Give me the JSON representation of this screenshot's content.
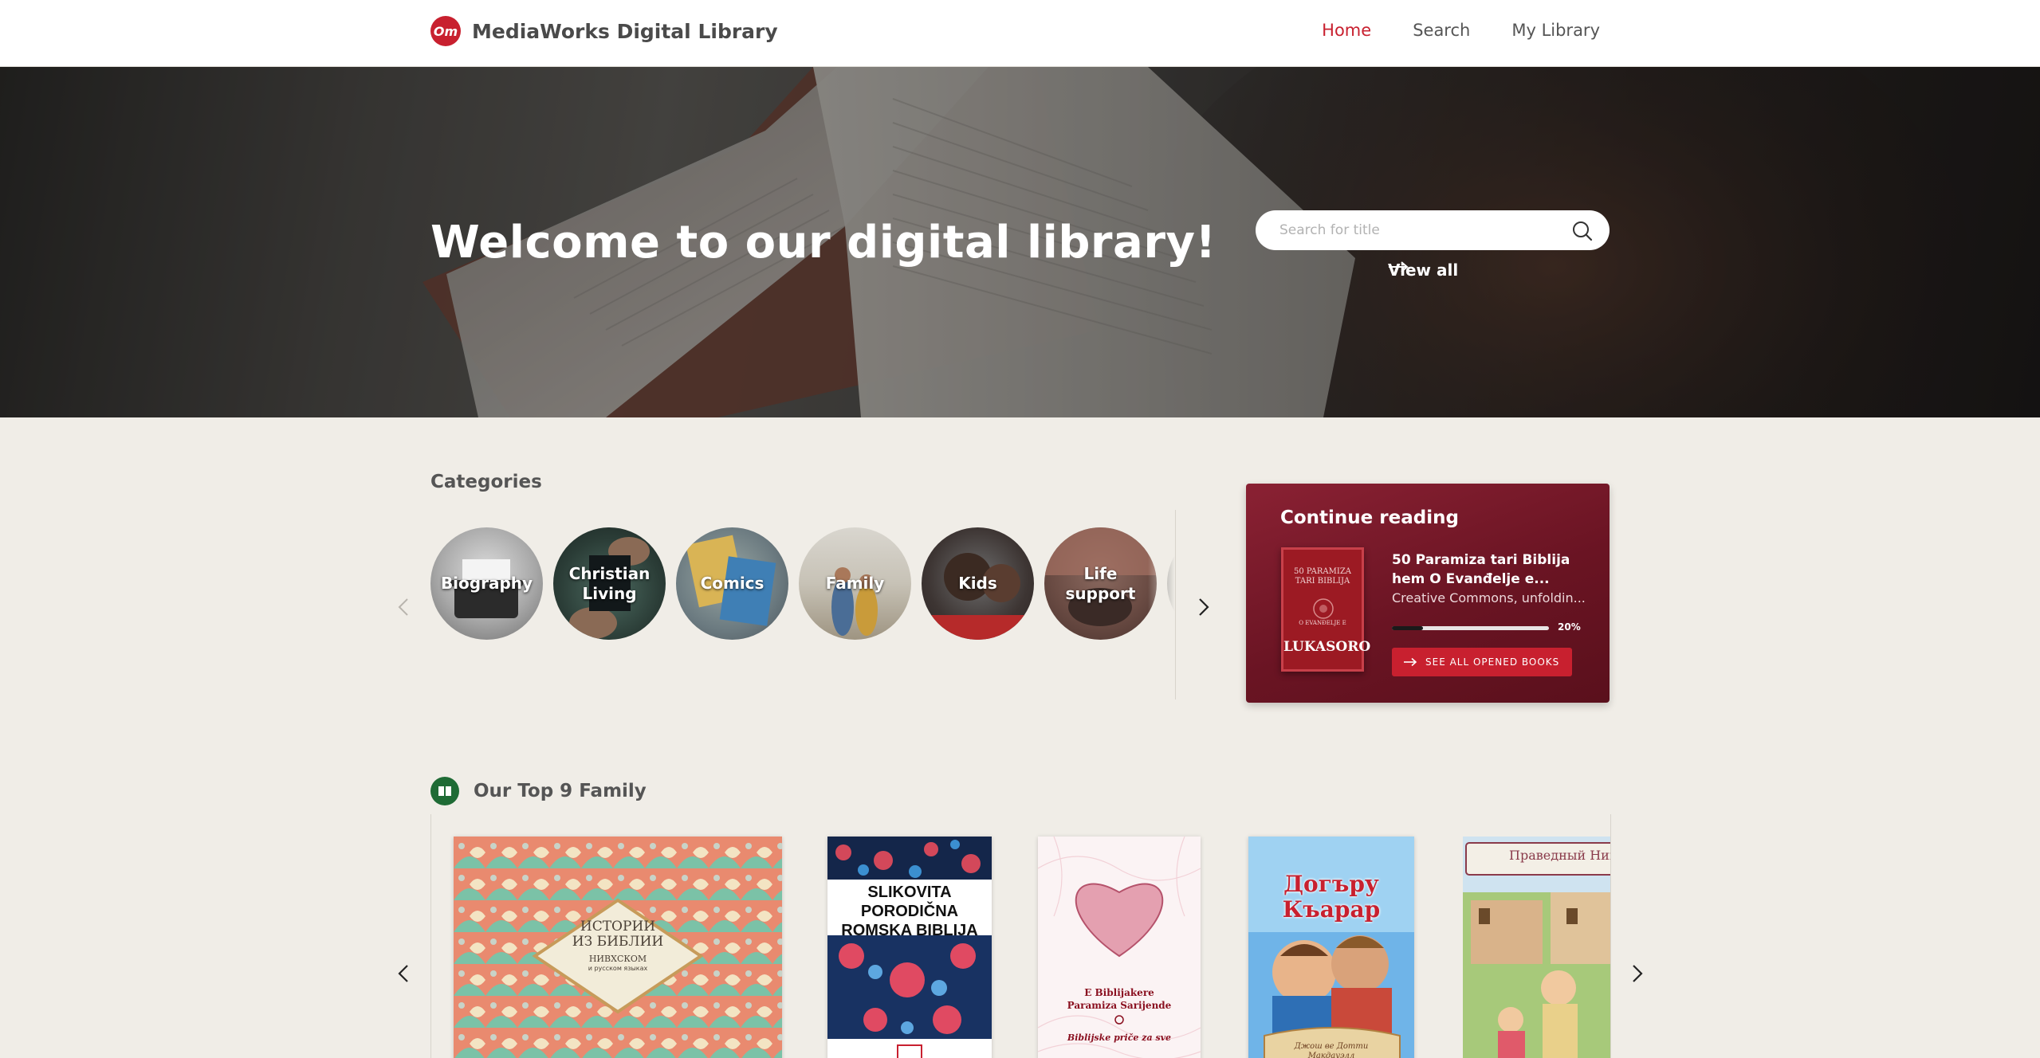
{
  "header": {
    "logo_text": "Om",
    "brand": "MediaWorks Digital Library",
    "nav": [
      {
        "label": "Home",
        "active": true
      },
      {
        "label": "Search",
        "active": false
      },
      {
        "label": "My Library",
        "active": false
      }
    ]
  },
  "hero": {
    "title": "Welcome to our digital library!",
    "search_placeholder": "Search for title",
    "view_all": "View all"
  },
  "categories": {
    "title": "Categories",
    "items": [
      "Biography",
      "Christian\nLiving",
      "Comics",
      "Family",
      "Kids",
      "Life\nsupport"
    ]
  },
  "continue_reading": {
    "title": "Continue reading",
    "book_title": "50 Paramiza tari Biblija hem O Evanđelje e...",
    "book_subtitle": "Creative Commons, unfoldin...",
    "cover_top": "50 PARAMIZA\nTARI BIBLIJA",
    "cover_mid": "O EVANĐELJE E",
    "cover_bottom": "LUKASORO",
    "progress_percent": 20,
    "progress_label": "20%",
    "button": "SEE ALL OPENED BOOKS"
  },
  "top9": {
    "title": "Our Top 9 Family",
    "books": [
      {
        "cover_title": "ИСТОРИИ\nИЗ БИБЛИИ",
        "cover_sub": "НИВХСКОМ",
        "cover_note": "и русском языках"
      },
      {
        "cover_title": "SLIKOVITA PORODIČNA\nROMSKA BIBLIJA"
      },
      {
        "cover_title": "E Biblijakere\nParamiza Sarijende",
        "cover_sub": "Biblijske priče za sve"
      },
      {
        "cover_title": "Догъру\nКъарар",
        "cover_sub": "Джош ве Дотти\nМакдауэлл"
      },
      {
        "cover_title": "Праведный Ник"
      }
    ]
  },
  "colors": {
    "accent": "#c8202f",
    "continue_bg": "#6a1423",
    "page_bg": "#f0ede7"
  }
}
